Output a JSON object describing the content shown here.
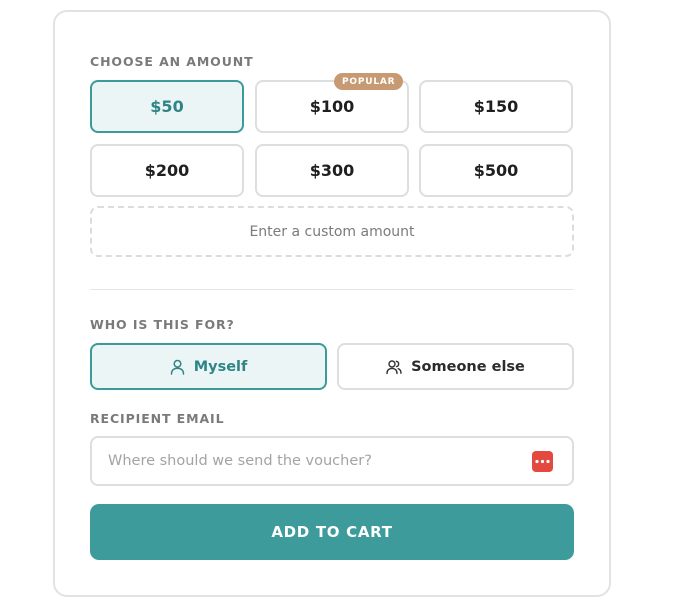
{
  "amount_section": {
    "label": "CHOOSE AN AMOUNT",
    "options": [
      {
        "label": "$50",
        "selected": true
      },
      {
        "label": "$100",
        "selected": false,
        "badge": "POPULAR"
      },
      {
        "label": "$150",
        "selected": false
      },
      {
        "label": "$200",
        "selected": false
      },
      {
        "label": "$300",
        "selected": false
      },
      {
        "label": "$500",
        "selected": false
      }
    ],
    "custom_amount_label": "Enter a custom amount"
  },
  "recipient_section": {
    "label": "WHO IS THIS FOR?",
    "options": [
      {
        "label": "Myself",
        "icon": "user-icon",
        "selected": true
      },
      {
        "label": "Someone else",
        "icon": "users-icon",
        "selected": false
      }
    ]
  },
  "email_section": {
    "label": "RECIPIENT EMAIL",
    "placeholder": "Where should we send the voucher?",
    "value": "",
    "autofill_icon": "password-dots-icon"
  },
  "cart_button_label": "ADD TO CART",
  "colors": {
    "accent": "#3d9b9b",
    "selected_bg": "#ecf5f5",
    "badge": "#c79a73",
    "autofill_icon": "#e3493f"
  }
}
